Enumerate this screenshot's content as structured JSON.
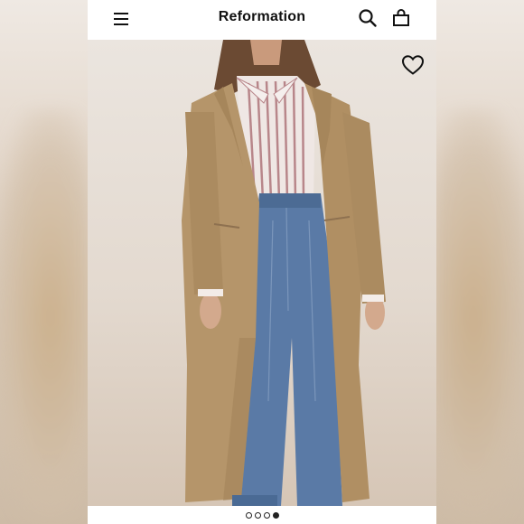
{
  "header": {
    "brand": "Reformation",
    "menu_icon": "hamburger-menu-icon",
    "search_icon": "search-icon",
    "bag_icon": "shopping-bag-icon"
  },
  "product_image": {
    "alt": "",
    "wishlist_icon": "heart-outline-icon"
  },
  "carousel": {
    "count": 4,
    "active_index": 3
  },
  "colors": {
    "brand_text": "#111111",
    "coat": "#b5956a",
    "denim": "#5a7aa6",
    "background": "#ffffff"
  }
}
